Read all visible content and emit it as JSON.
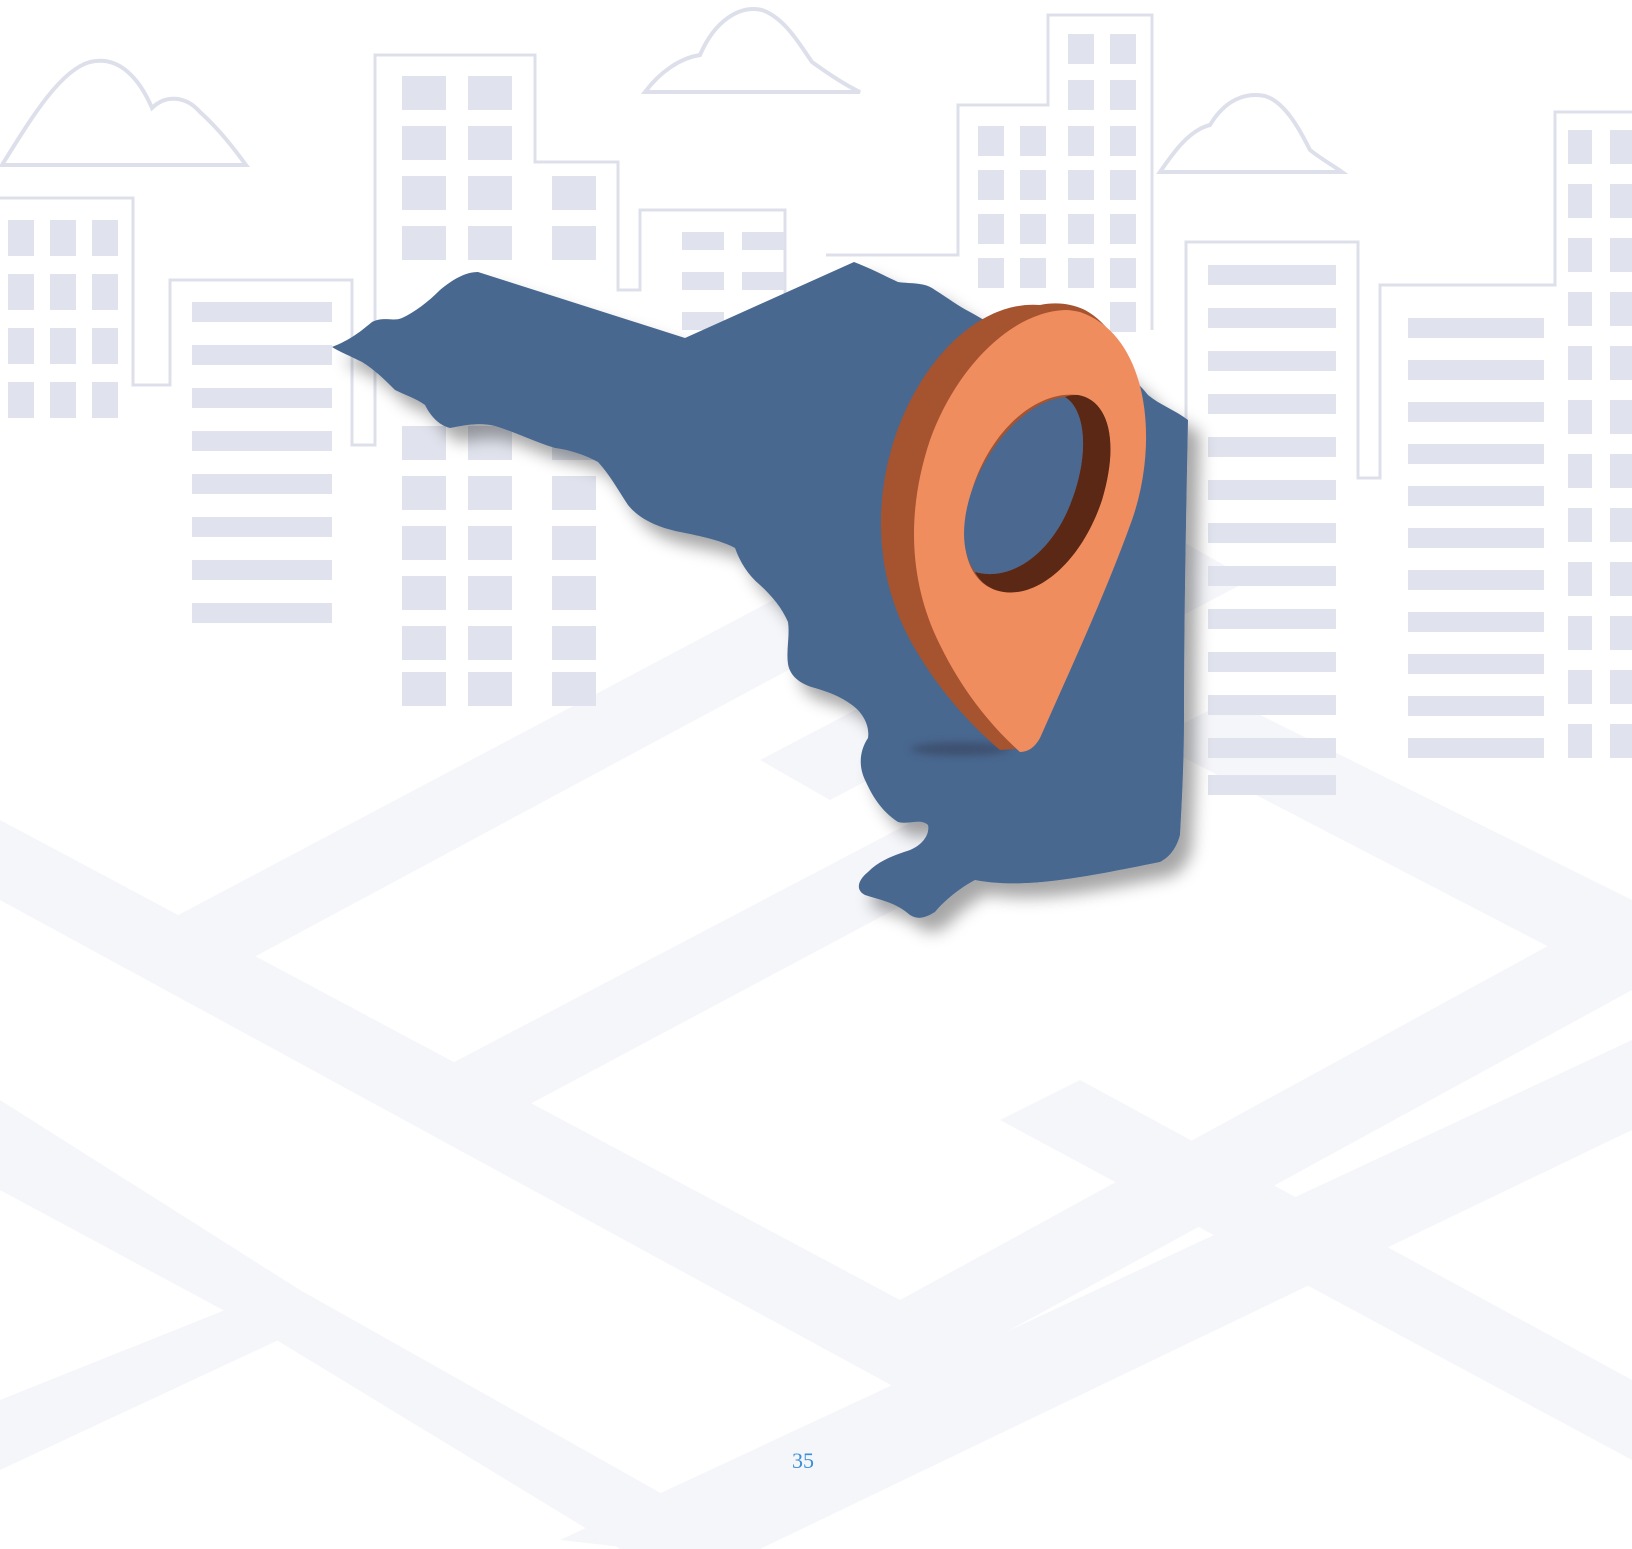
{
  "page": {
    "page_number": "35"
  },
  "illustration": {
    "subject": "state-map-with-location-pin",
    "icons": [
      "location-pin-icon",
      "cloud-icon",
      "building-icon"
    ],
    "colors": {
      "map_fill": "#4a6890",
      "pin_face": "#f08d5f",
      "pin_side": "#a6532f",
      "pin_hole_inner": "#5a2814",
      "building_outline": "#dde0ea",
      "building_window": "#e0e3ed",
      "ground_street": "#f5f6fa",
      "page_number": "#3b8fd6"
    }
  }
}
